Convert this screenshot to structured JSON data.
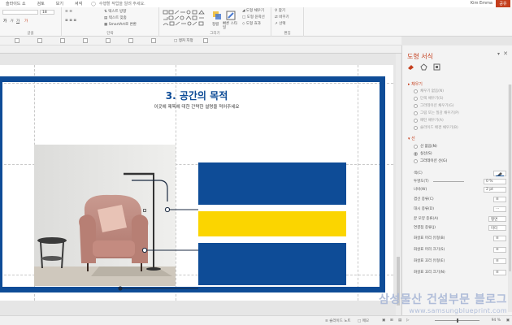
{
  "tabs": {
    "items": [
      "슬라이드 쇼",
      "검토",
      "보기",
      "서식"
    ],
    "tell_me": "수행할 작업을 알려 주세요.",
    "user": "Kim Emma",
    "share": "공유"
  },
  "ribbon": {
    "font_size": "18",
    "text_direction": "텍스트 방향",
    "text_align": "텍스트 맞춤",
    "smartart": "SmartArt로 변환",
    "group_font": "글꼴",
    "group_paragraph": "단락",
    "group_drawing": "그리기",
    "group_editing": "편집",
    "arrange": "정렬",
    "quick_styles": "빠른 스타일",
    "shape_fill": "도형 채우기",
    "shape_outline": "도형 윤곽선",
    "shape_effects": "도형 효과",
    "find": "찾기",
    "replace": "바꾸기",
    "select": "선택"
  },
  "quickbar": {
    "anchor_label": "앵커 지정"
  },
  "slide": {
    "title": "3. 공간의 목적",
    "subtitle": "이곳에 제목에 대한 간략한 설명을 적어주세요"
  },
  "pane": {
    "title": "도형 서식",
    "fill_section": "채우기",
    "fill_options": [
      "채우기 없음(N)",
      "단색 채우기(S)",
      "그라데이션 채우기(G)",
      "그림 또는 질감 채우기(P)",
      "패턴 채우기(A)",
      "슬라이드 배경 채우기(B)"
    ],
    "line_section": "선",
    "line_options": [
      "선 없음(N)",
      "실선(S)",
      "그라데이션 선(G)"
    ],
    "selected_line_option": "실선(S)",
    "props": [
      {
        "label": "색(C)",
        "value": ""
      },
      {
        "label": "투명도(T)",
        "value": "0 %"
      },
      {
        "label": "너비(W)",
        "value": "2 pt"
      },
      {
        "label": "겹선 종류(C)",
        "value": ""
      },
      {
        "label": "대시 종류(D)",
        "value": ""
      },
      {
        "label": "끝 모양 종류(A)",
        "value": "평면"
      },
      {
        "label": "연결점 종류(J)",
        "value": "미터"
      },
      {
        "label": "화살표 머리 유형(B)",
        "value": ""
      },
      {
        "label": "화살표 머리 크기(S)",
        "value": ""
      },
      {
        "label": "화살표 꼬리 유형(E)",
        "value": ""
      },
      {
        "label": "화살표 꼬리 크기(N)",
        "value": ""
      }
    ]
  },
  "status": {
    "notes": "슬라이드 노트",
    "comments": "메모",
    "zoom": "94 %"
  },
  "watermark": {
    "line1": "삼성물산 건설부문 블로그",
    "line2": "www.samsungblueprint.com"
  },
  "colors": {
    "accent_blue": "#0e4c97",
    "accent_yellow": "#fbd500",
    "office_red": "#c43e1c"
  }
}
